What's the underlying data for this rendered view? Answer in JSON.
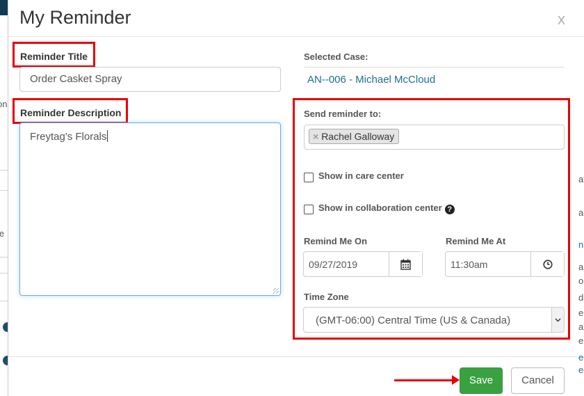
{
  "background": {
    "left_fragments": [
      "on",
      "ie"
    ],
    "right_fragments": [
      "ata",
      "ag",
      "n",
      "al",
      "or",
      "da",
      "ek",
      "ar",
      "elo",
      "ed",
      "ect"
    ]
  },
  "modal": {
    "title": "My Reminder",
    "close_label": "x",
    "reminder_title": {
      "label": "Reminder Title",
      "value": "Order Casket Spray"
    },
    "reminder_description": {
      "label": "Reminder Description",
      "value": "Freytag's Florals"
    },
    "selected_case": {
      "label": "Selected Case:",
      "value": "AN--006 - Michael McCloud"
    },
    "send_to": {
      "label": "Send reminder to:",
      "recipients": [
        "Rachel Galloway"
      ],
      "remove_glyph": "×"
    },
    "show_in_care_center": {
      "label": "Show in care center",
      "checked": false
    },
    "show_in_collaboration_center": {
      "label": "Show in collaboration center",
      "checked": false,
      "help_glyph": "?"
    },
    "remind_on": {
      "label": "Remind Me On",
      "value": "09/27/2019",
      "icon": "calendar-icon"
    },
    "remind_at": {
      "label": "Remind Me At",
      "value": "11:30am",
      "icon": "clock-icon"
    },
    "time_zone": {
      "label": "Time Zone",
      "value": "(GMT-06:00) Central Time (US & Canada)"
    },
    "footer": {
      "save_label": "Save",
      "cancel_label": "Cancel"
    }
  },
  "colors": {
    "annotation_red": "#e60000",
    "save_green": "#3aa141",
    "link_blue": "#1f6d93",
    "focus_blue": "#66afe9"
  }
}
